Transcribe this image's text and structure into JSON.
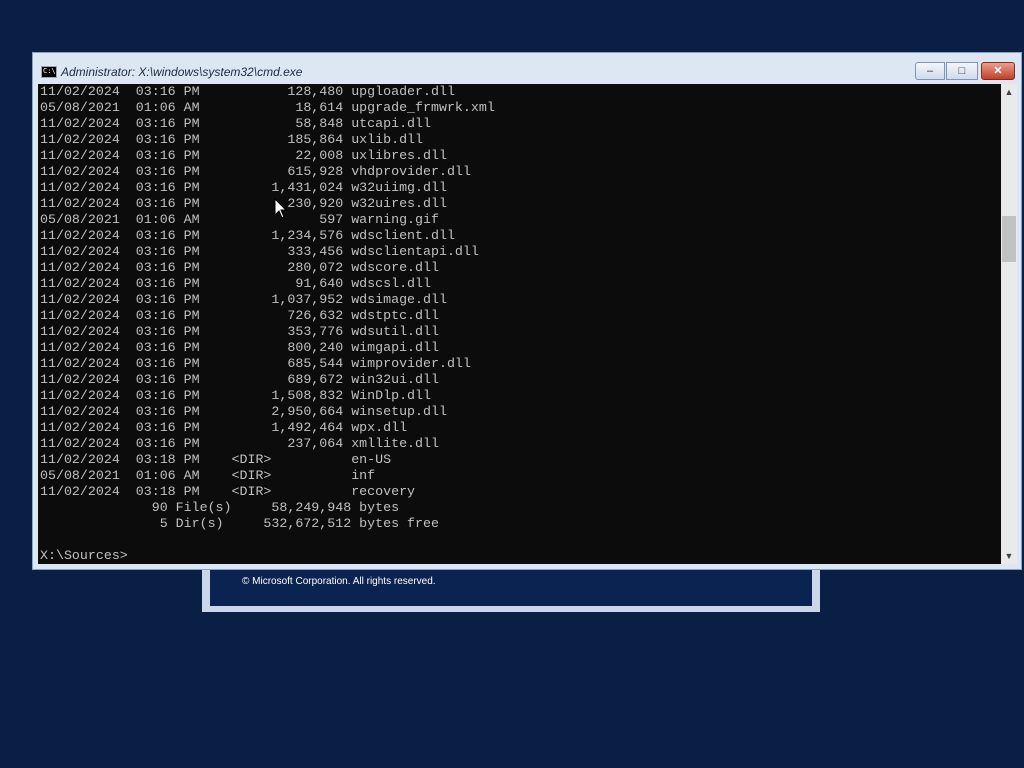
{
  "setup_dialog": {
    "copyright": "© Microsoft Corporation. All rights reserved."
  },
  "window": {
    "title": "Administrator: X:\\windows\\system32\\cmd.exe",
    "icon_text": "C:\\"
  },
  "buttons": {
    "minimize": "–",
    "maximize": "□",
    "close": "✕"
  },
  "scrollbar": {
    "up": "▲",
    "down": "▼"
  },
  "console": {
    "lines": [
      "11/02/2024  03:16 PM           128,480 upgloader.dll",
      "05/08/2021  01:06 AM            18,614 upgrade_frmwrk.xml",
      "11/02/2024  03:16 PM            58,848 utcapi.dll",
      "11/02/2024  03:16 PM           185,864 uxlib.dll",
      "11/02/2024  03:16 PM            22,008 uxlibres.dll",
      "11/02/2024  03:16 PM           615,928 vhdprovider.dll",
      "11/02/2024  03:16 PM         1,431,024 w32uiimg.dll",
      "11/02/2024  03:16 PM           230,920 w32uires.dll",
      "05/08/2021  01:06 AM               597 warning.gif",
      "11/02/2024  03:16 PM         1,234,576 wdsclient.dll",
      "11/02/2024  03:16 PM           333,456 wdsclientapi.dll",
      "11/02/2024  03:16 PM           280,072 wdscore.dll",
      "11/02/2024  03:16 PM            91,640 wdscsl.dll",
      "11/02/2024  03:16 PM         1,037,952 wdsimage.dll",
      "11/02/2024  03:16 PM           726,632 wdstptc.dll",
      "11/02/2024  03:16 PM           353,776 wdsutil.dll",
      "11/02/2024  03:16 PM           800,240 wimgapi.dll",
      "11/02/2024  03:16 PM           685,544 wimprovider.dll",
      "11/02/2024  03:16 PM           689,672 win32ui.dll",
      "11/02/2024  03:16 PM         1,508,832 WinDlp.dll",
      "11/02/2024  03:16 PM         2,950,664 winsetup.dll",
      "11/02/2024  03:16 PM         1,492,464 wpx.dll",
      "11/02/2024  03:16 PM           237,064 xmllite.dll",
      "11/02/2024  03:18 PM    <DIR>          en-US",
      "05/08/2021  01:06 AM    <DIR>          inf",
      "11/02/2024  03:18 PM    <DIR>          recovery",
      "              90 File(s)     58,249,948 bytes",
      "               5 Dir(s)     532,672,512 bytes free",
      "",
      "X:\\Sources>"
    ]
  }
}
